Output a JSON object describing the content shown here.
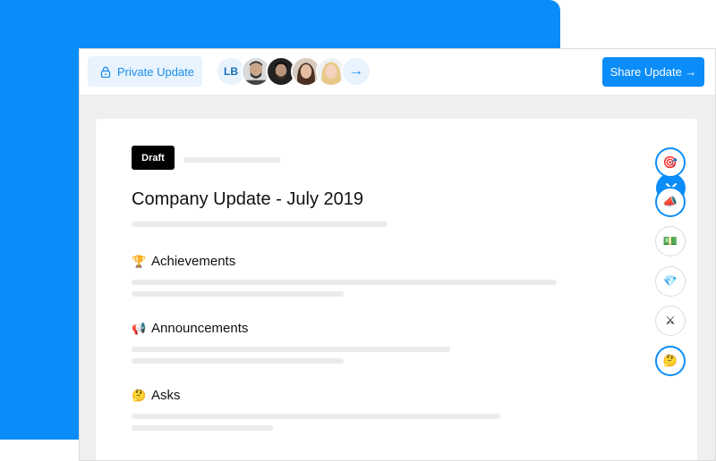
{
  "topbar": {
    "private_label": "Private Update",
    "avatars": [
      {
        "initials": "LB"
      }
    ],
    "more_arrow": "→",
    "share_label": "Share Update →"
  },
  "document": {
    "badge": "Draft",
    "title": "Company Update - July 2019",
    "sections": [
      {
        "emoji": "🏆",
        "heading": "Achievements"
      },
      {
        "emoji": "📢",
        "heading": "Announcements"
      },
      {
        "emoji": "🤔",
        "heading": "Asks"
      }
    ]
  },
  "sidebar_icons": [
    {
      "emoji": "🎯",
      "name": "target"
    },
    {
      "emoji": "📣",
      "name": "megaphone"
    },
    {
      "emoji": "💵",
      "name": "money"
    },
    {
      "emoji": "💎",
      "name": "gem"
    },
    {
      "emoji": "⚔",
      "name": "swords"
    },
    {
      "emoji": "🤔",
      "name": "thinking"
    }
  ],
  "colors": {
    "accent": "#0a8df8",
    "accent_light": "#e8f3fd"
  }
}
